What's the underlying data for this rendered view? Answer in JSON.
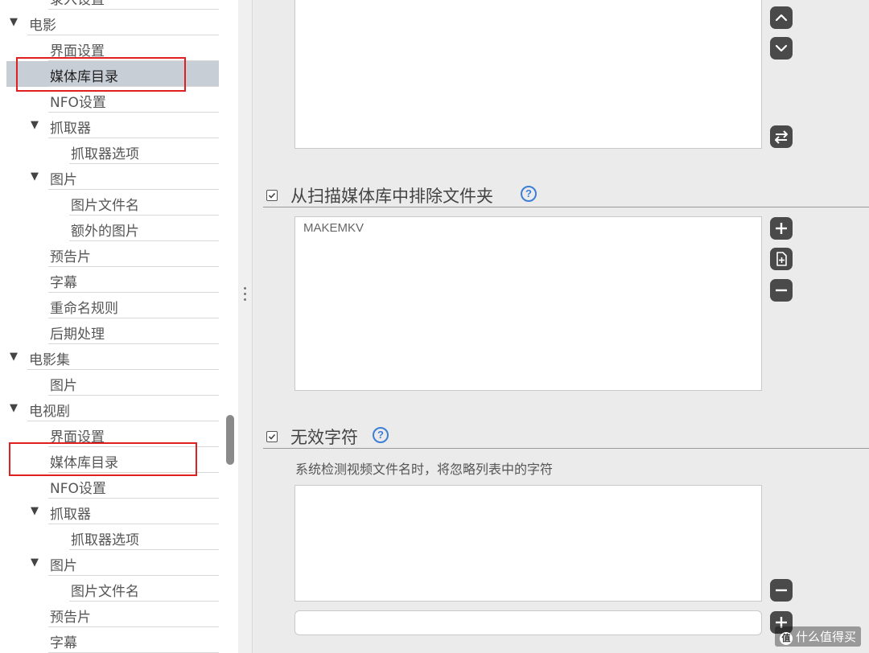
{
  "sidebar": {
    "cut_top_label": "录入设置",
    "items": [
      {
        "label": "电影",
        "level": 0,
        "expanded": true
      },
      {
        "label": "界面设置",
        "level": 1
      },
      {
        "label": "媒体库目录",
        "level": 1,
        "selected": true
      },
      {
        "label": "NFO设置",
        "level": 1
      },
      {
        "label": "抓取器",
        "level": 1,
        "expanded": true
      },
      {
        "label": "抓取器选项",
        "level": 2
      },
      {
        "label": "图片",
        "level": 1,
        "expanded": true
      },
      {
        "label": "图片文件名",
        "level": 2
      },
      {
        "label": "额外的图片",
        "level": 2
      },
      {
        "label": "预告片",
        "level": 1
      },
      {
        "label": "字幕",
        "level": 1
      },
      {
        "label": "重命名规则",
        "level": 1
      },
      {
        "label": "后期处理",
        "level": 1
      },
      {
        "label": "电影集",
        "level": 0,
        "expanded": true
      },
      {
        "label": "图片",
        "level": 1
      },
      {
        "label": "电视剧",
        "level": 0,
        "expanded": true
      },
      {
        "label": "界面设置",
        "level": 1
      },
      {
        "label": "媒体库目录",
        "level": 1
      },
      {
        "label": "NFO设置",
        "level": 1
      },
      {
        "label": "抓取器",
        "level": 1,
        "expanded": true
      },
      {
        "label": "抓取器选项",
        "level": 2
      },
      {
        "label": "图片",
        "level": 1,
        "expanded": true
      },
      {
        "label": "图片文件名",
        "level": 2
      },
      {
        "label": "预告片",
        "level": 1
      }
    ],
    "cut_bottom_label": "字幕"
  },
  "main": {
    "exclude_section": {
      "title": "从扫描媒体库中排除文件夹",
      "help": "?",
      "checked": true,
      "items": [
        "MAKEMKV"
      ]
    },
    "invalid_chars_section": {
      "title": "无效字符",
      "help": "?",
      "checked": true,
      "description": "系统检测视频文件名时，将忽略列表中的字符",
      "input_value": ""
    }
  },
  "watermark": {
    "icon": "值",
    "text": "什么值得买"
  },
  "colors": {
    "selection_bg": "#c8ced6",
    "highlight_box": "#e02020",
    "help_icon": "#3d7fd6",
    "button_bg": "#4a4a4a"
  },
  "icons": {
    "up": "chevron-up-icon",
    "down": "chevron-down-icon",
    "swap": "swap-arrows-icon",
    "add": "plus-icon",
    "add_file": "add-file-icon",
    "remove": "minus-icon"
  }
}
